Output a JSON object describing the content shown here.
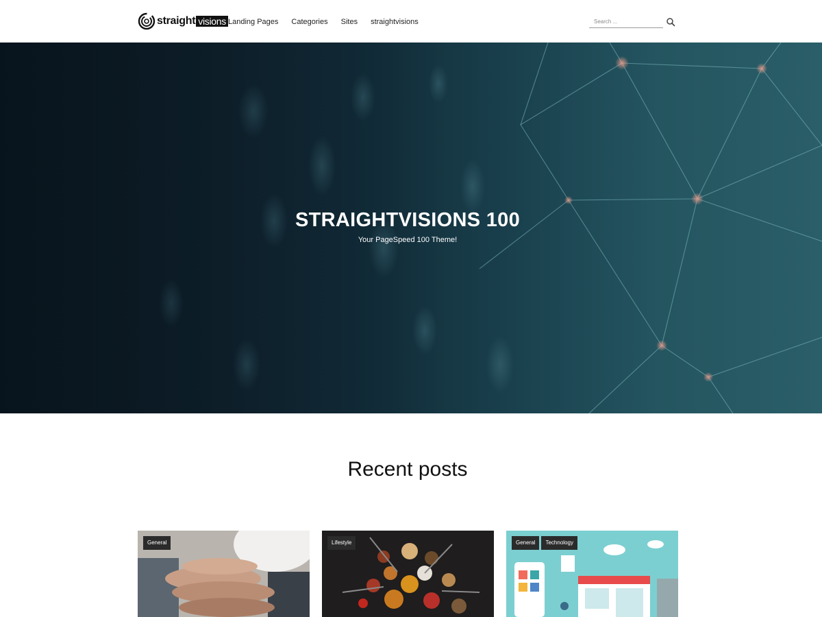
{
  "header": {
    "logo": {
      "text_a": "straight",
      "text_b": "visions"
    },
    "nav": [
      "Landing Pages",
      "Categories",
      "Sites",
      "straightvisions"
    ],
    "search": {
      "placeholder": "Search ..."
    }
  },
  "hero": {
    "title": "STRAIGHTVISIONS 100",
    "subtitle": "Your PageSpeed 100 Theme!"
  },
  "recent_posts": {
    "title": "Recent posts",
    "posts": [
      {
        "image": "hands-stacked-teamwork",
        "categories": [
          "General"
        ]
      },
      {
        "image": "spices-on-spoons",
        "categories": [
          "Lifestyle"
        ]
      },
      {
        "image": "online-shop-illustration",
        "categories": [
          "General",
          "Technology"
        ]
      }
    ]
  },
  "colors": {
    "badge_bg": "#2b2b2b",
    "hero_bg": "#122d3a",
    "card3_bg": "#7ccfd0"
  }
}
